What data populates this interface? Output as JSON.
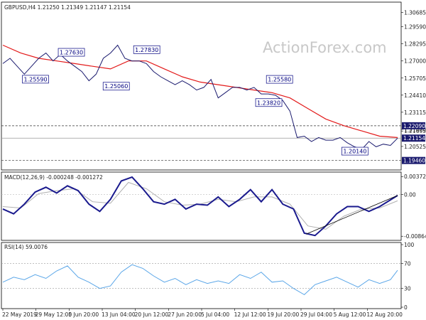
{
  "chart_data": [
    {
      "type": "candlestick",
      "title": "GBPUSD,H4  1.21250 1.21349 1.21147 1.21154",
      "watermark": "ActionForex.com",
      "ylim": [
        1.1885,
        1.3135
      ],
      "yticks": [
        "1.30685",
        "1.29590",
        "1.28295",
        "1.27000",
        "1.25705",
        "1.24410",
        "1.23115",
        "1.21820",
        "1.20525"
      ],
      "extra_ticks": [
        "1.21695"
      ],
      "xlabels": [
        "22 May 2019",
        "29 May 12:00",
        "5 Jun 20:00",
        "13 Jun 04:00",
        "20 Jun 12:00",
        "27 Jun 20:00",
        "5 Jul 04:00",
        "12 Jul 12:00",
        "19 Jul 20:00",
        "29 Jul 04:00",
        "5 Aug 12:00",
        "12 Aug 20:00"
      ],
      "price_series": {
        "name": "close",
        "x": [
          0,
          4,
          8,
          12,
          16,
          20,
          24,
          28,
          32,
          36,
          40,
          44,
          48,
          52,
          56,
          60,
          64,
          68,
          72,
          76,
          80,
          84,
          88,
          92,
          96,
          100,
          104,
          108,
          112,
          116,
          120,
          124,
          128,
          132,
          136,
          140,
          144,
          148,
          152,
          156,
          160,
          164,
          168,
          172,
          176,
          180,
          184,
          188,
          192,
          196,
          200,
          204,
          208,
          212,
          216,
          220
        ],
        "values": [
          1.268,
          1.272,
          1.266,
          1.26,
          1.266,
          1.272,
          1.276,
          1.27,
          1.275,
          1.27,
          1.266,
          1.262,
          1.255,
          1.26,
          1.272,
          1.276,
          1.282,
          1.272,
          1.27,
          1.27,
          1.268,
          1.262,
          1.258,
          1.255,
          1.252,
          1.255,
          1.252,
          1.248,
          1.25,
          1.256,
          1.242,
          1.246,
          1.25,
          1.25,
          1.248,
          1.25,
          1.245,
          1.245,
          1.244,
          1.24,
          1.232,
          1.212,
          1.213,
          1.209,
          1.212,
          1.21,
          1.21,
          1.212,
          1.208,
          1.205,
          1.203,
          1.209,
          1.205,
          1.207,
          1.206,
          1.2115
        ]
      },
      "ma_series": {
        "x": [
          0,
          10,
          20,
          30,
          40,
          50,
          60,
          70,
          80,
          90,
          100,
          110,
          120,
          130,
          140,
          150,
          160,
          170,
          180,
          190,
          200,
          210,
          220
        ],
        "values": [
          1.282,
          1.276,
          1.272,
          1.27,
          1.268,
          1.266,
          1.264,
          1.27,
          1.27,
          1.264,
          1.258,
          1.254,
          1.252,
          1.25,
          1.248,
          1.246,
          1.242,
          1.234,
          1.226,
          1.221,
          1.217,
          1.213,
          1.212
        ]
      },
      "swing_labels": [
        {
          "text": "1.27630",
          "x": 38,
          "y": 1.2763
        },
        {
          "text": "1.25590",
          "x": 18,
          "y": 1.2559
        },
        {
          "text": "1.27830",
          "x": 80,
          "y": 1.2783
        },
        {
          "text": "1.25060",
          "x": 63,
          "y": 1.2506
        },
        {
          "text": "1.25580",
          "x": 154,
          "y": 1.2558
        },
        {
          "text": "1.23820",
          "x": 148,
          "y": 1.2382
        },
        {
          "text": "1.20140",
          "x": 196,
          "y": 1.2014
        }
      ],
      "horizontal_levels": [
        {
          "value": 1.2209,
          "label": "1.22090",
          "style": "dashed"
        },
        {
          "value": 1.21154,
          "label": "1.21154",
          "style": "solid"
        },
        {
          "value": 1.1946,
          "label": "1.19460",
          "style": "dashed"
        }
      ]
    },
    {
      "type": "line",
      "title": "MACD(12,26,9) -0.000248 -0.001272",
      "ylim": [
        -0.0092,
        0.0042
      ],
      "yticks": [
        "0.003722",
        "0.00",
        "-0.008643"
      ],
      "series": [
        {
          "name": "macd",
          "x": [
            0,
            6,
            12,
            18,
            24,
            30,
            36,
            42,
            48,
            54,
            60,
            66,
            72,
            78,
            84,
            90,
            96,
            102,
            108,
            114,
            120,
            126,
            132,
            138,
            144,
            150,
            156,
            162,
            168,
            174,
            180,
            186,
            192,
            198,
            204,
            210,
            220
          ],
          "values": [
            -0.003,
            -0.004,
            -0.002,
            0.0005,
            0.0015,
            0.0003,
            0.0018,
            0.0008,
            -0.002,
            -0.0035,
            -0.001,
            0.0028,
            0.0036,
            0.0012,
            -0.0015,
            -0.002,
            -0.001,
            -0.003,
            -0.002,
            -0.0022,
            -0.0005,
            -0.0025,
            -0.001,
            0.001,
            -0.0015,
            0.001,
            -0.002,
            -0.003,
            -0.008,
            -0.0085,
            -0.0065,
            -0.004,
            -0.0025,
            -0.0025,
            -0.0035,
            -0.0025,
            -0.0002
          ]
        },
        {
          "name": "signal",
          "x": [
            0,
            10,
            20,
            30,
            40,
            50,
            60,
            70,
            80,
            90,
            100,
            110,
            120,
            130,
            140,
            150,
            160,
            170,
            180,
            190,
            200,
            210,
            220
          ],
          "values": [
            -0.0025,
            -0.0028,
            0.0002,
            0.0008,
            0.0012,
            -0.0015,
            -0.0018,
            0.0025,
            0.0012,
            -0.0015,
            -0.0022,
            -0.002,
            -0.001,
            -0.0015,
            -0.0005,
            -0.0005,
            -0.002,
            -0.0065,
            -0.0072,
            -0.0045,
            -0.003,
            -0.0028,
            -0.0013
          ]
        }
      ],
      "trendline": {
        "x": [
          169,
          220
        ],
        "values": [
          -0.0082,
          -0.0002
        ]
      }
    },
    {
      "type": "line",
      "title": "RSI(14) 59.0076",
      "ylim": [
        0,
        100
      ],
      "yticks": [
        "100",
        "70",
        "30",
        "0"
      ],
      "series": [
        {
          "name": "rsi",
          "x": [
            0,
            6,
            12,
            18,
            24,
            30,
            36,
            42,
            48,
            54,
            60,
            66,
            72,
            78,
            84,
            90,
            96,
            102,
            108,
            114,
            120,
            126,
            132,
            138,
            144,
            150,
            156,
            162,
            168,
            174,
            180,
            186,
            192,
            198,
            204,
            210,
            216,
            220
          ],
          "values": [
            40,
            48,
            44,
            52,
            46,
            58,
            66,
            48,
            40,
            30,
            34,
            56,
            68,
            62,
            50,
            40,
            46,
            36,
            44,
            38,
            42,
            38,
            52,
            46,
            56,
            40,
            42,
            30,
            20,
            36,
            42,
            48,
            40,
            32,
            44,
            38,
            44,
            59
          ]
        }
      ]
    }
  ]
}
